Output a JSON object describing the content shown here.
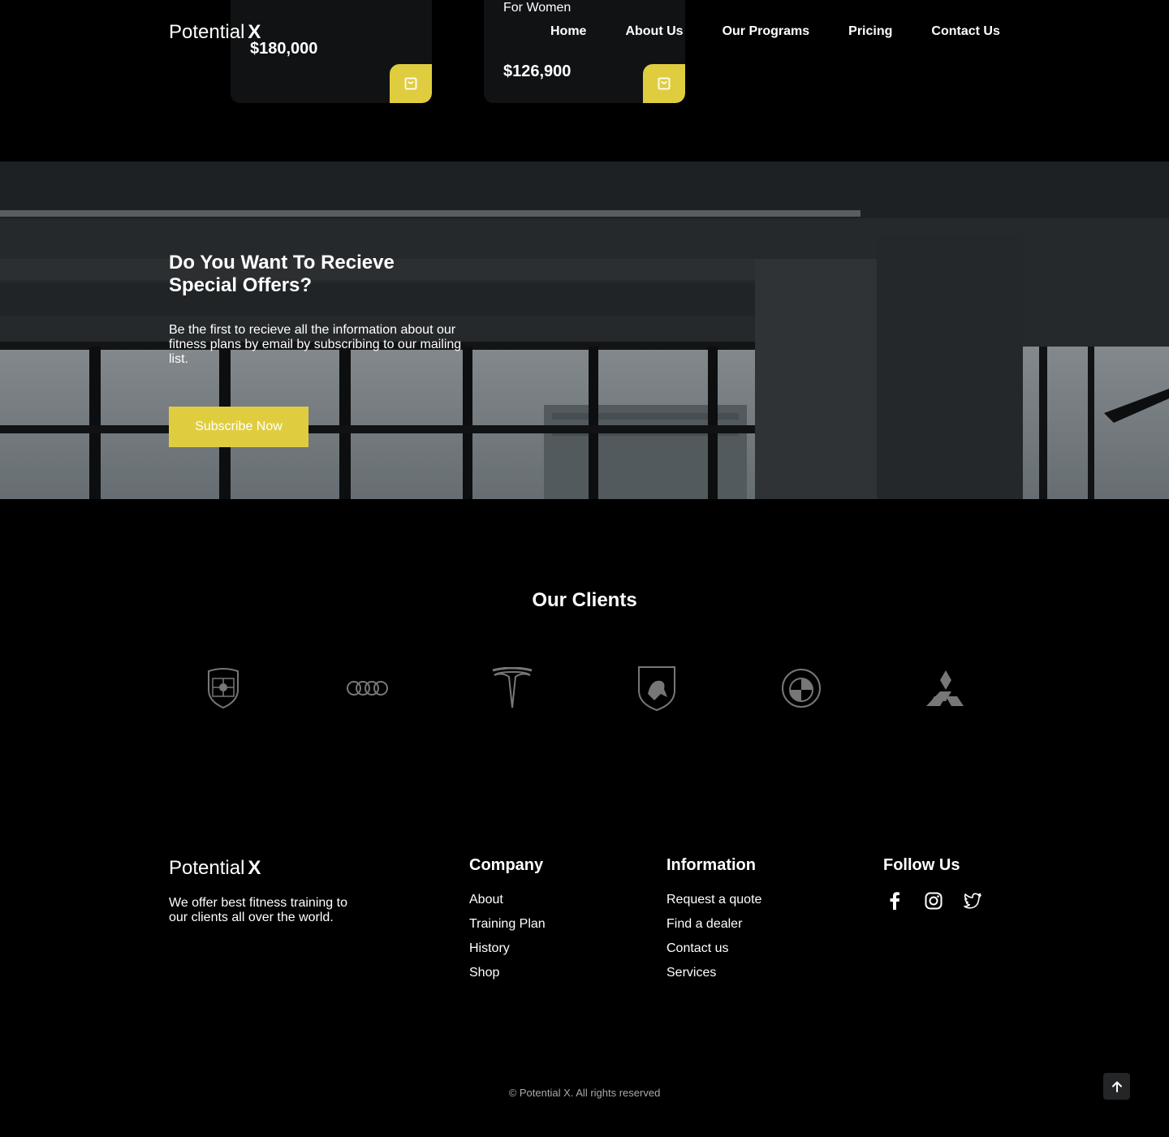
{
  "products": [
    {
      "subtitle": "",
      "price": "$180,000"
    },
    {
      "subtitle": "For Women",
      "price": "$126,900"
    }
  ],
  "header": {
    "logo_text": "Potential",
    "logo_mark": "X",
    "nav": [
      "Home",
      "About Us",
      "Our Programs",
      "Pricing",
      "Contact Us"
    ]
  },
  "subscribe": {
    "title": "Do You Want To Recieve Special Offers?",
    "text": "Be the first to recieve all the information about our fitness plans by email by subscribing to our mailing list.",
    "button": "Subscribe Now"
  },
  "clients": {
    "title": "Our Clients",
    "logos": [
      "porsche-logo-icon",
      "audi-logo-icon",
      "tesla-logo-icon",
      "lamborghini-logo-icon",
      "bmw-logo-icon",
      "mitsubishi-logo-icon"
    ]
  },
  "footer": {
    "logo_text": "Potential",
    "logo_mark": "X",
    "description": "We offer best fitness training to our clients all over the world.",
    "company": {
      "title": "Company",
      "links": [
        "About",
        "Training Plan",
        "History",
        "Shop"
      ]
    },
    "information": {
      "title": "Information",
      "links": [
        "Request a quote",
        "Find a dealer",
        "Contact us",
        "Services"
      ]
    },
    "follow": {
      "title": "Follow Us",
      "icons": [
        "facebook-icon",
        "instagram-icon",
        "twitter-icon"
      ]
    },
    "copyright": "© Potential X. All rights reserved"
  },
  "colors": {
    "accent": "#e0cd3f",
    "background": "#000000",
    "card": "#111214"
  }
}
